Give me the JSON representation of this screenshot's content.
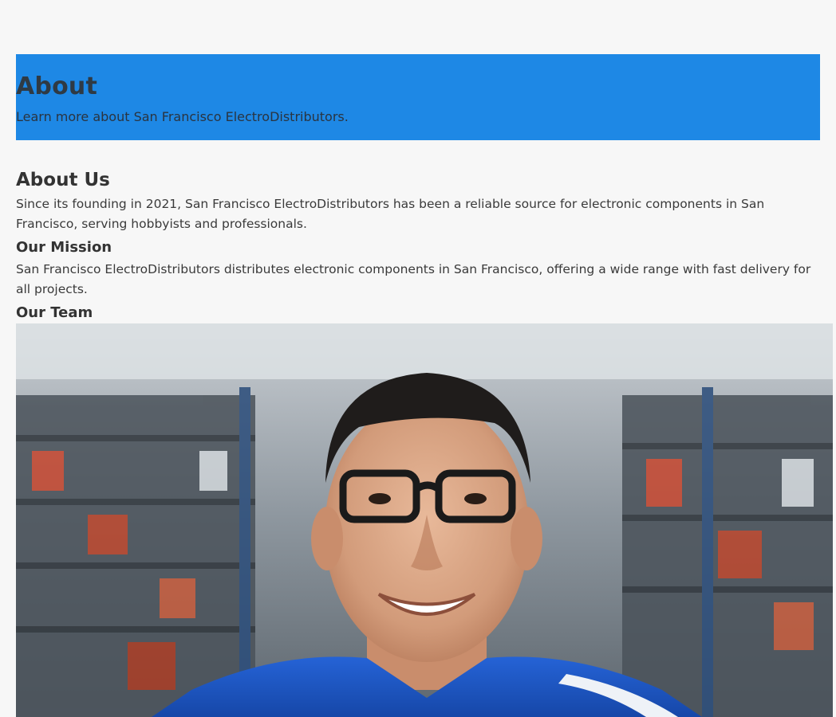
{
  "hero": {
    "title": "About",
    "subtitle": "Learn more about San Francisco ElectroDistributors."
  },
  "about": {
    "heading": "About Us",
    "text": "Since its founding in 2021, San Francisco ElectroDistributors has been a reliable source for electronic components in San Francisco, serving hobbyists and professionals."
  },
  "mission": {
    "heading": "Our Mission",
    "text": "San Francisco ElectroDistributors distributes electronic components in San Francisco, offering a wide range with fast delivery for all projects."
  },
  "team": {
    "heading": "Our Team"
  },
  "colors": {
    "hero_background": "#1e88e5",
    "page_background": "#f7f7f7",
    "shirt": "#1a56c8"
  }
}
